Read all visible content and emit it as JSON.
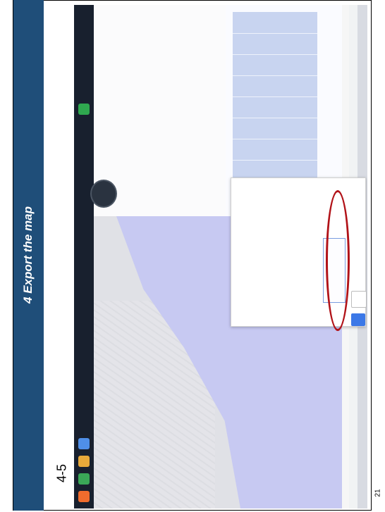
{
  "slide": {
    "title": "4 Export the map",
    "step": "4-5",
    "page_number": "21"
  },
  "colors": {
    "title_bar": "#1f4e79",
    "highlight": "#b11218",
    "run_button": "#3b78e7"
  },
  "icons": [
    "chrome-icon",
    "firefox-icon",
    "file-explorer-icon",
    "start-icon"
  ]
}
